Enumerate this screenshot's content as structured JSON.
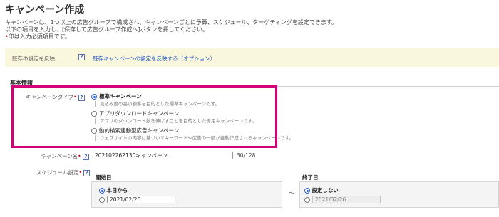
{
  "page": {
    "title": "キャンペーン作成",
    "desc_line1": "キャンペーンは、1つ以上の広告グループで構成され、キャンペーンごとに予算、スケジュール、ターゲティングを設定できます。",
    "desc_line2": "以下の項目を入力し、[保存して広告グループ作成へ]ボタンを押してください。",
    "required_star": "•",
    "required_note": "印は入力必須項目です。"
  },
  "banner": {
    "label": "既存の設定を反映",
    "help": "?",
    "link": "既存キャンペーンの設定を反映する（オプション）"
  },
  "basic": {
    "section_title": "基本情報",
    "campaign_type": {
      "label": "キャンペーンタイプ",
      "star": "•",
      "help": "?",
      "options": [
        {
          "label": "標準キャンペーン",
          "desc": "見込み度の高い顧客を目的とした標準キャンペーンです。",
          "checked": true
        },
        {
          "label": "アプリダウンロードキャンペーン",
          "desc": "アプリのダウンロード数を伸ばすことを目的とした専用キャンペーンです。",
          "checked": false
        },
        {
          "label": "動的検索連動型広告キャンペーン",
          "desc": "ウェブサイトの内容に基づいてキーワードや広告の一部が自動作成されるキャンペーンです。",
          "checked": false
        }
      ]
    },
    "campaign_name": {
      "label": "キャンペーン名",
      "star": "•",
      "help": "?",
      "value": "202102262130キャンペーン",
      "count": "30/128"
    },
    "schedule": {
      "label": "スケジュール設定",
      "star": "•",
      "help": "?",
      "start_header": "開始日",
      "end_header": "終了日",
      "separator": "～",
      "start_options": {
        "today": "本日から",
        "date": "2021/02/26"
      },
      "end_options": {
        "none": "設定しない",
        "date": "2021/02/26"
      }
    }
  },
  "colors": {
    "highlight": "#d4007a",
    "link": "#1a57c9",
    "required": "#d0021b",
    "banner_bg": "#fbf7dd"
  }
}
